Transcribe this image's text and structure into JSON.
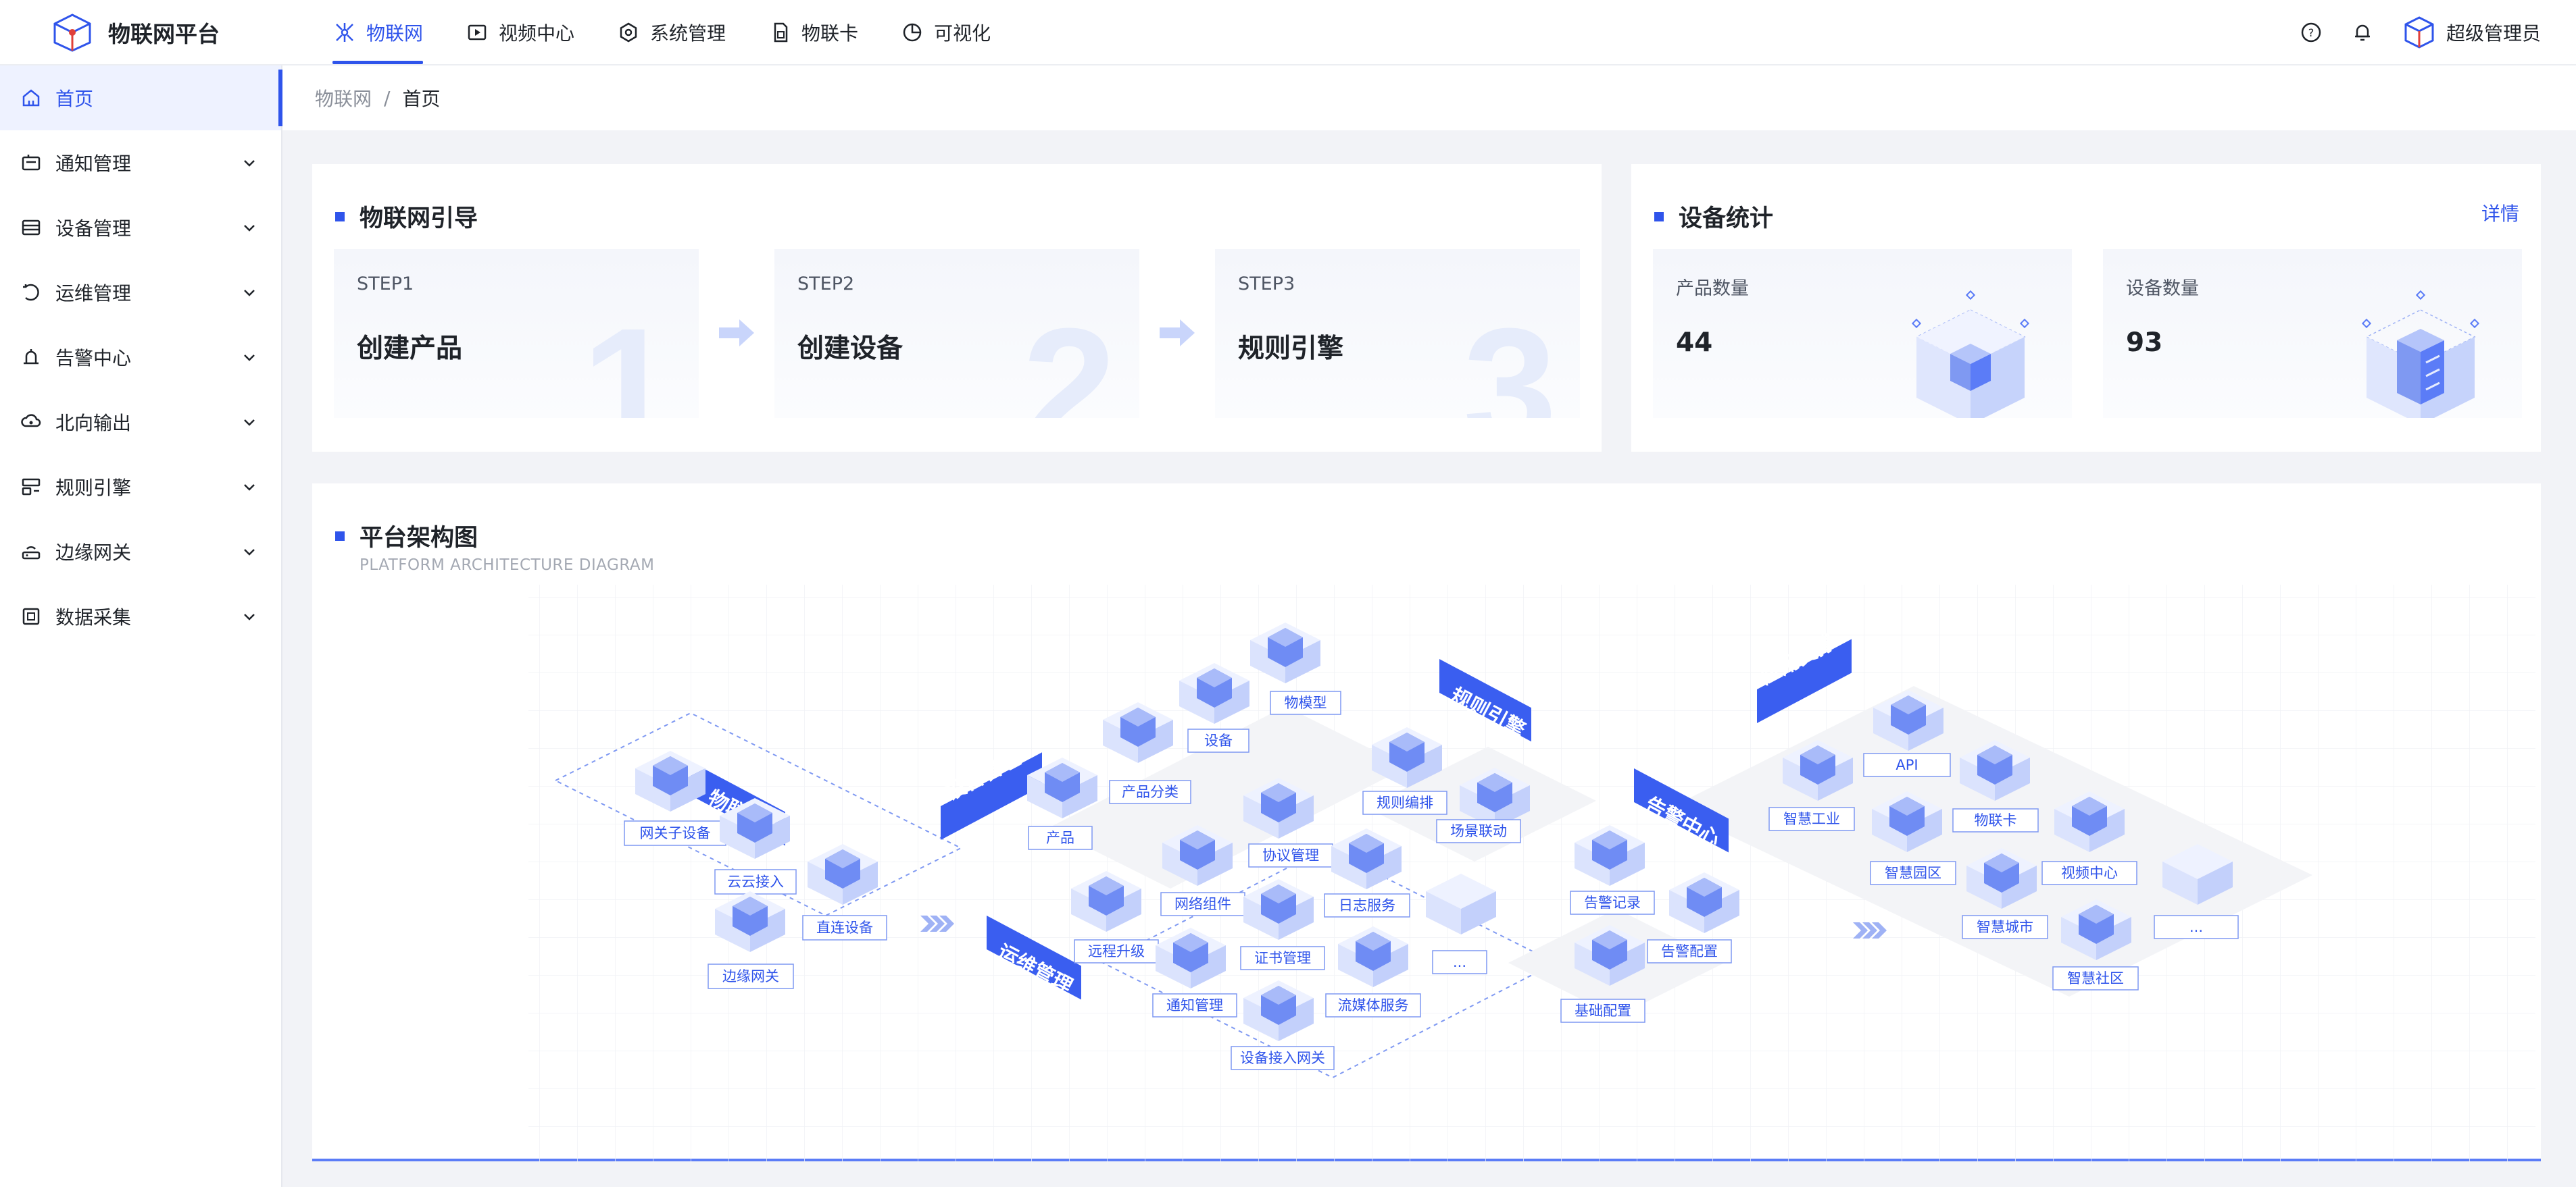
{
  "app": {
    "title": "物联网平台"
  },
  "topnav": [
    {
      "label": "物联网",
      "icon": "network-icon",
      "active": true
    },
    {
      "label": "视频中心",
      "icon": "video-icon"
    },
    {
      "label": "系统管理",
      "icon": "settings-icon"
    },
    {
      "label": "物联卡",
      "icon": "sim-card-icon"
    },
    {
      "label": "可视化",
      "icon": "pie-chart-icon"
    }
  ],
  "user": {
    "name": "超级管理员"
  },
  "sidebar": {
    "items": [
      {
        "label": "首页",
        "icon": "home-icon",
        "active": true
      },
      {
        "label": "通知管理",
        "icon": "notice-icon"
      },
      {
        "label": "设备管理",
        "icon": "device-icon"
      },
      {
        "label": "运维管理",
        "icon": "ops-icon"
      },
      {
        "label": "告警中心",
        "icon": "alarm-icon"
      },
      {
        "label": "北向输出",
        "icon": "output-icon"
      },
      {
        "label": "规则引擎",
        "icon": "rule-icon"
      },
      {
        "label": "边缘网关",
        "icon": "gateway-icon"
      },
      {
        "label": "数据采集",
        "icon": "data-collect-icon"
      }
    ]
  },
  "breadcrumb": {
    "root": "物联网",
    "separator": "/",
    "current": "首页"
  },
  "guide": {
    "title": "物联网引导",
    "steps": [
      {
        "label": "STEP1",
        "name": "创建产品",
        "number": "1"
      },
      {
        "label": "STEP2",
        "name": "创建设备",
        "number": "2"
      },
      {
        "label": "STEP3",
        "name": "规则引擎",
        "number": "3"
      }
    ]
  },
  "stats": {
    "title": "设备统计",
    "detail": "详情",
    "items": [
      {
        "label": "产品数量",
        "value": "44"
      },
      {
        "label": "设备数量",
        "value": "93"
      }
    ]
  },
  "arch": {
    "title": "平台架构图",
    "subtitle": "PLATFORM ARCHITECTURE DIAGRAM",
    "groups": {
      "access": {
        "tag": "物联接入",
        "items": [
          "网关子设备",
          "云云接入",
          "直连设备",
          "边缘网关"
        ]
      },
      "device": {
        "tag": "设备管理",
        "items": [
          "物模型",
          "设备",
          "产品分类",
          "产品"
        ]
      },
      "ops": {
        "tag": "运维管理",
        "items": [
          "协议管理",
          "网络组件",
          "日志服务",
          "远程升级",
          "证书管理",
          "...",
          "通知管理",
          "流媒体服务",
          "设备接入网关"
        ]
      },
      "rule": {
        "tag": "规则引擎",
        "items": [
          "规则编排",
          "场景联动"
        ]
      },
      "alarm": {
        "tag": "告警中心",
        "items": [
          "告警记录",
          "告警配置",
          "基础配置"
        ]
      },
      "app": {
        "tag": "应用支撑",
        "items": [
          "API",
          "智慧工业",
          "物联卡",
          "智慧园区",
          "视频中心",
          "智慧城市",
          "...",
          "智慧社区"
        ]
      }
    }
  },
  "colors": {
    "primary": "#2f54eb",
    "background": "#f2f3f7"
  }
}
